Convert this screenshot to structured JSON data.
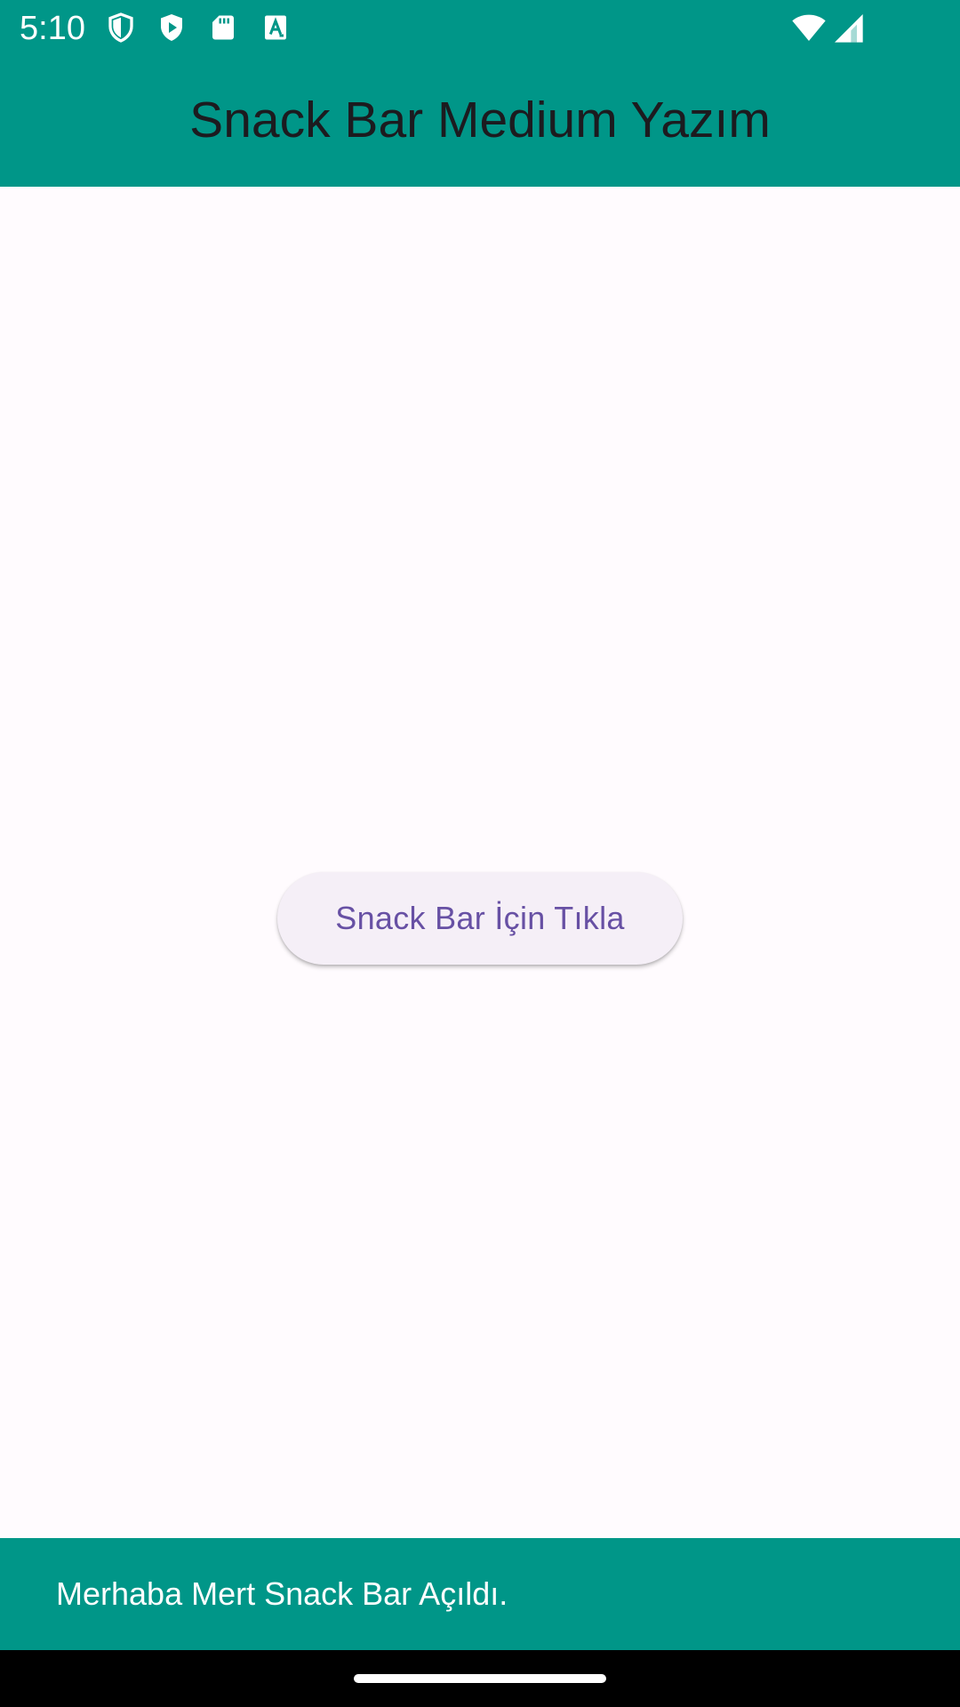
{
  "status_bar": {
    "time": "5:10",
    "icons": [
      "shield-icon",
      "play-store-icon",
      "sd-card-icon",
      "font-a-icon",
      "wifi-icon",
      "signal-icon"
    ],
    "background": "#009688"
  },
  "app_bar": {
    "title": "Snack Bar Medium Yazım",
    "background": "#009688",
    "title_color": "#1C1B1F"
  },
  "main": {
    "button_label": "Snack Bar İçin Tıkla",
    "button_background": "#F5EFF7",
    "button_text_color": "#6750A4",
    "background": "#FFFBFE"
  },
  "snackbar": {
    "message": "Merhaba Mert Snack Bar Açıldı.",
    "background": "#009688"
  },
  "nav_bar": {
    "background": "#000000"
  }
}
